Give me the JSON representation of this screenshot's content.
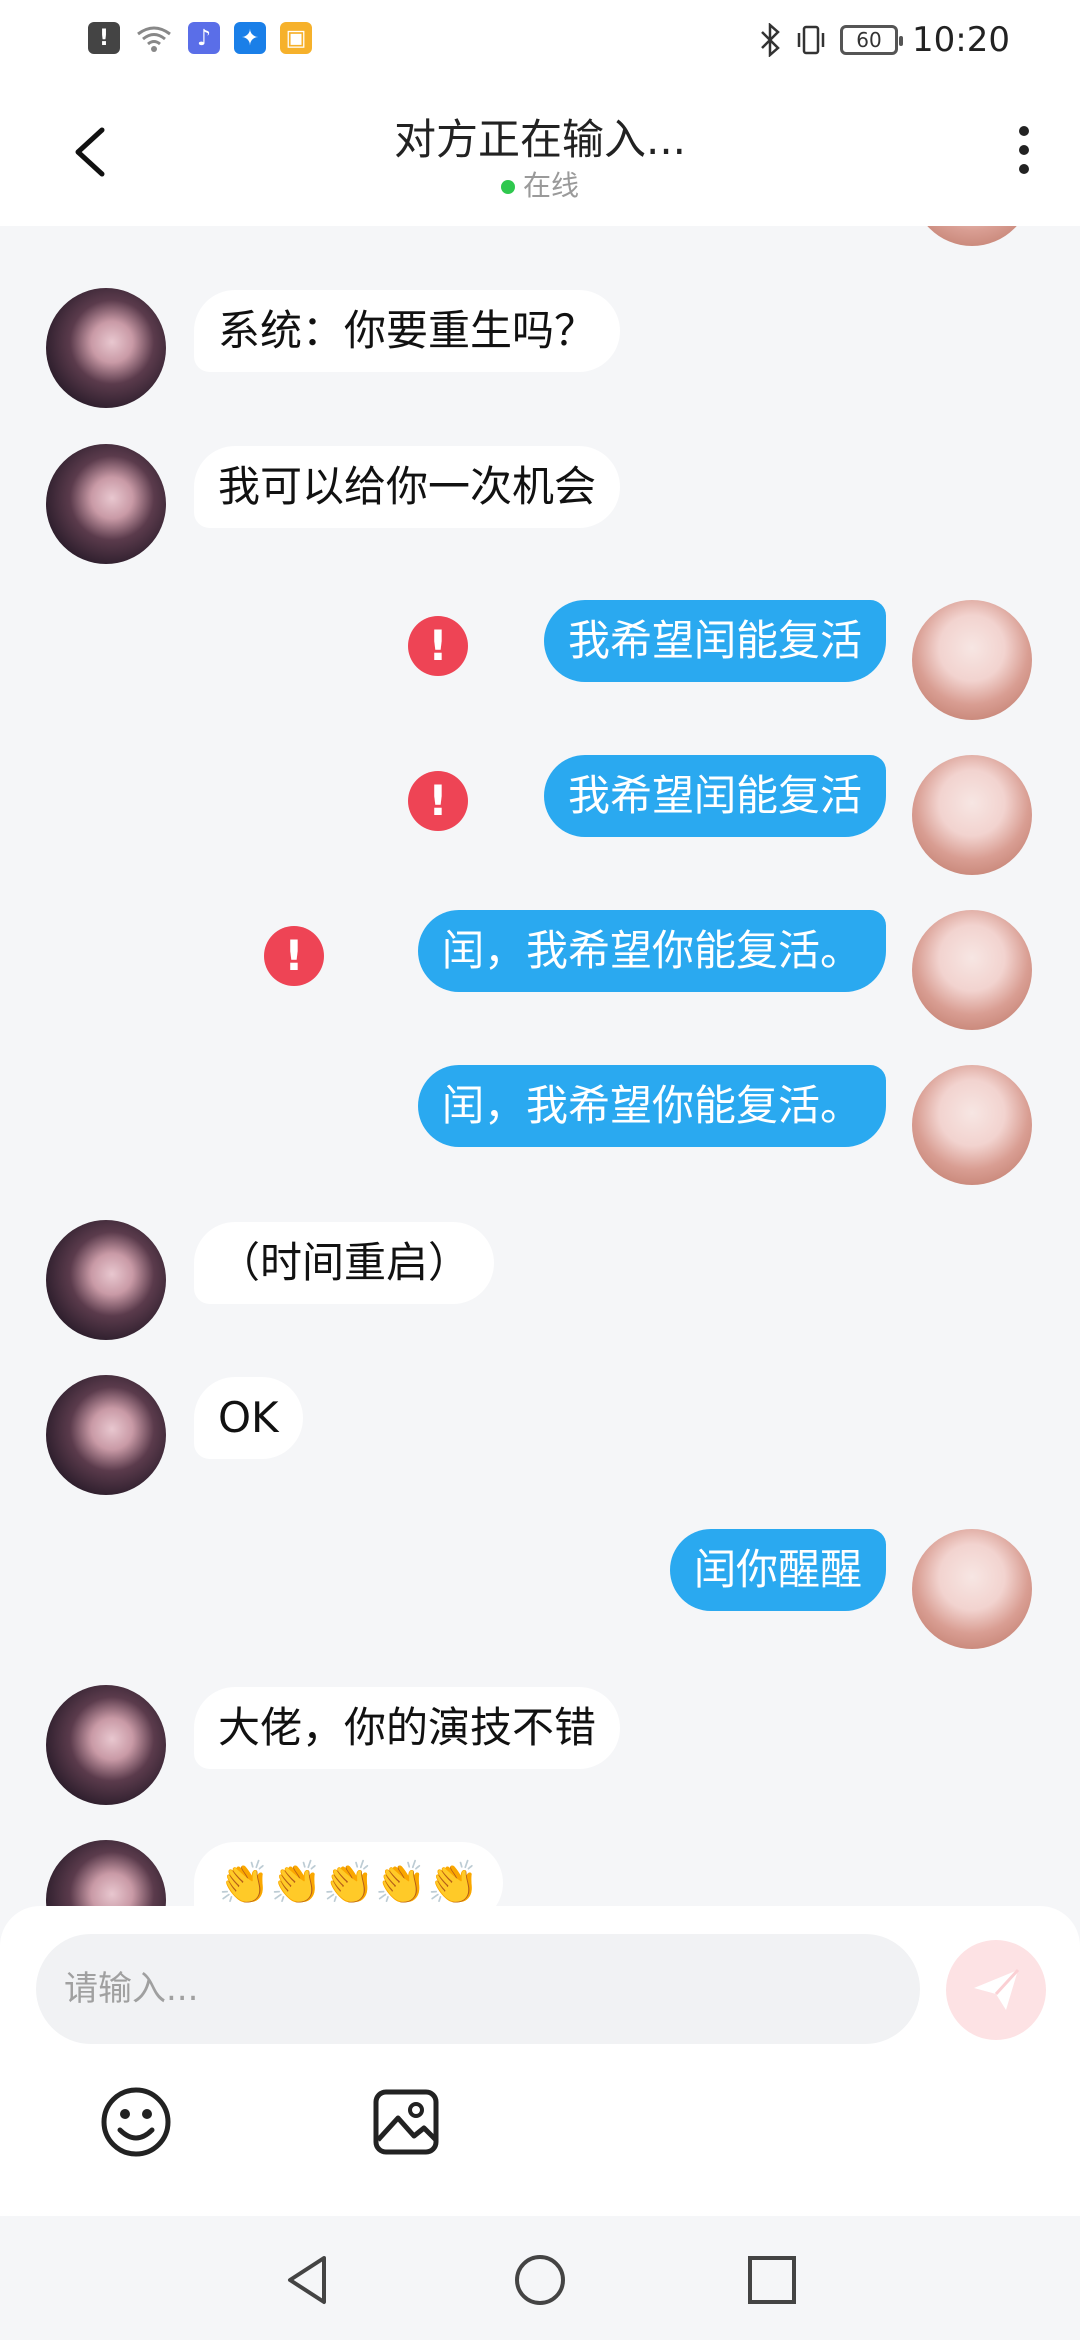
{
  "status_bar": {
    "time": "10:20",
    "battery": "60",
    "left_icons": [
      "alert-icon",
      "wifi-icon",
      "music-app-icon",
      "bulb-app-icon",
      "notes-app-icon"
    ],
    "right_icons": [
      "bluetooth-icon",
      "vibrate-icon"
    ]
  },
  "header": {
    "title": "对方正在输入...",
    "status": "在线",
    "status_color": "#2fc84e"
  },
  "messages": [
    {
      "side": "in",
      "text": "系统：你要重生吗？",
      "failed": false
    },
    {
      "side": "in",
      "text": "我可以给你一次机会",
      "failed": false
    },
    {
      "side": "out",
      "text": "我希望闰能复活",
      "failed": true
    },
    {
      "side": "out",
      "text": "我希望闰能复活",
      "failed": true
    },
    {
      "side": "out",
      "text": "闰，我希望你能复活。",
      "failed": true
    },
    {
      "side": "out",
      "text": "闰，我希望你能复活。",
      "failed": false
    },
    {
      "side": "in",
      "text": "（时间重启）",
      "failed": false
    },
    {
      "side": "in",
      "text": "OK",
      "failed": false
    },
    {
      "side": "out",
      "text": "闰你醒醒",
      "failed": false
    },
    {
      "side": "in",
      "text": "大佬，你的演技不错",
      "failed": false
    },
    {
      "side": "in",
      "text": "👏👏👏👏👏",
      "failed": false
    }
  ],
  "input": {
    "placeholder": "请输入..."
  },
  "colors": {
    "outgoing_bubble": "#2aa9f0",
    "error": "#ee4455",
    "send_button": "#fde2e4"
  }
}
